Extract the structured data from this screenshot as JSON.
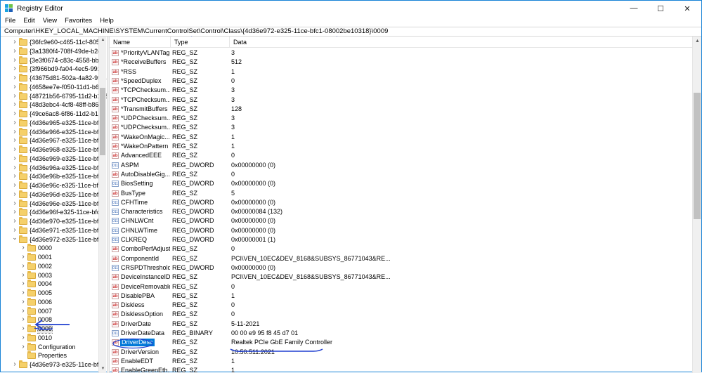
{
  "window": {
    "title": "Registry Editor",
    "icon": "registry-editor-icon",
    "controls": {
      "minimize": "—",
      "maximize": "☐",
      "close": "✕"
    }
  },
  "menu": [
    "File",
    "Edit",
    "View",
    "Favorites",
    "Help"
  ],
  "address": {
    "prefix": "Computer\\HKEY_LOCAL_MACHINE\\SYSTEM\\CurrentControlSet\\Control\\Class\\",
    "highlighted": "{4d36e972-e325-11ce-bfc1-08002be10318}\\0009"
  },
  "tree": {
    "items": [
      {
        "label": "{36fc9e60-c465-11cf-8056-",
        "level": 1,
        "expanded": false
      },
      {
        "label": "{3a1380f4-708f-49de-b2ef-",
        "level": 1,
        "expanded": false
      },
      {
        "label": "{3e3f0674-c83c-4558-bb26",
        "level": 1,
        "expanded": false
      },
      {
        "label": "{3f966bd9-fa04-4ec5-991c-",
        "level": 1,
        "expanded": false
      },
      {
        "label": "{43675d81-502a-4a82-9f84",
        "level": 1,
        "expanded": false
      },
      {
        "label": "{4658ee7e-f050-11d1-b6bd",
        "level": 1,
        "expanded": false
      },
      {
        "label": "{48721b56-6795-11d2-b1a8",
        "level": 1,
        "expanded": false
      },
      {
        "label": "{48d3ebc4-4cf8-48ff-b869-",
        "level": 1,
        "expanded": false
      },
      {
        "label": "{49ce6ac8-6f86-11d2-b1e5",
        "level": 1,
        "expanded": false
      },
      {
        "label": "{4d36e965-e325-11ce-bfc1",
        "level": 1,
        "expanded": false
      },
      {
        "label": "{4d36e966-e325-11ce-bfc1",
        "level": 1,
        "expanded": false
      },
      {
        "label": "{4d36e967-e325-11ce-bfc1",
        "level": 1,
        "expanded": false
      },
      {
        "label": "{4d36e968-e325-11ce-bfc1",
        "level": 1,
        "expanded": false
      },
      {
        "label": "{4d36e969-e325-11ce-bfc1",
        "level": 1,
        "expanded": false
      },
      {
        "label": "{4d36e96a-e325-11ce-bfc1",
        "level": 1,
        "expanded": false
      },
      {
        "label": "{4d36e96b-e325-11ce-bfc1",
        "level": 1,
        "expanded": false
      },
      {
        "label": "{4d36e96c-e325-11ce-bfc1",
        "level": 1,
        "expanded": false
      },
      {
        "label": "{4d36e96d-e325-11ce-bfc1",
        "level": 1,
        "expanded": false
      },
      {
        "label": "{4d36e96e-e325-11ce-bfc1",
        "level": 1,
        "expanded": false
      },
      {
        "label": "{4d36e96f-e325-11ce-bfc1-",
        "level": 1,
        "expanded": false
      },
      {
        "label": "{4d36e970-e325-11ce-bfc1",
        "level": 1,
        "expanded": false
      },
      {
        "label": "{4d36e971-e325-11ce-bfc1",
        "level": 1,
        "expanded": false
      },
      {
        "label": "{4d36e972-e325-11ce-bfc1",
        "level": 1,
        "expanded": true
      },
      {
        "label": "0000",
        "level": 2,
        "expanded": false
      },
      {
        "label": "0001",
        "level": 2,
        "expanded": false
      },
      {
        "label": "0002",
        "level": 2,
        "expanded": false
      },
      {
        "label": "0003",
        "level": 2,
        "expanded": false
      },
      {
        "label": "0004",
        "level": 2,
        "expanded": false
      },
      {
        "label": "0005",
        "level": 2,
        "expanded": false
      },
      {
        "label": "0006",
        "level": 2,
        "expanded": false
      },
      {
        "label": "0007",
        "level": 2,
        "expanded": false
      },
      {
        "label": "0008",
        "level": 2,
        "expanded": false
      },
      {
        "label": "0009",
        "level": 2,
        "expanded": false,
        "selected": true
      },
      {
        "label": "0010",
        "level": 2,
        "expanded": false
      },
      {
        "label": "Configuration",
        "level": 2,
        "expanded": false
      },
      {
        "label": "Properties",
        "level": 2,
        "leaf": true
      },
      {
        "label": "{4d36e973-e325-11ce-bfc1",
        "level": 1,
        "expanded": false
      }
    ]
  },
  "columns": {
    "name": "Name",
    "type": "Type",
    "data": "Data"
  },
  "values": [
    {
      "name": "*PriorityVLANTag",
      "type": "REG_SZ",
      "data": "3"
    },
    {
      "name": "*ReceiveBuffers",
      "type": "REG_SZ",
      "data": "512"
    },
    {
      "name": "*RSS",
      "type": "REG_SZ",
      "data": "1"
    },
    {
      "name": "*SpeedDuplex",
      "type": "REG_SZ",
      "data": "0"
    },
    {
      "name": "*TCPChecksum...",
      "type": "REG_SZ",
      "data": "3"
    },
    {
      "name": "*TCPChecksum...",
      "type": "REG_SZ",
      "data": "3"
    },
    {
      "name": "*TransmitBuffers",
      "type": "REG_SZ",
      "data": "128"
    },
    {
      "name": "*UDPChecksum...",
      "type": "REG_SZ",
      "data": "3"
    },
    {
      "name": "*UDPChecksum...",
      "type": "REG_SZ",
      "data": "3"
    },
    {
      "name": "*WakeOnMagic...",
      "type": "REG_SZ",
      "data": "1"
    },
    {
      "name": "*WakeOnPattern",
      "type": "REG_SZ",
      "data": "1"
    },
    {
      "name": "AdvancedEEE",
      "type": "REG_SZ",
      "data": "0"
    },
    {
      "name": "ASPM",
      "type": "REG_DWORD",
      "data": "0x00000000 (0)"
    },
    {
      "name": "AutoDisableGig...",
      "type": "REG_SZ",
      "data": "0"
    },
    {
      "name": "BiosSetting",
      "type": "REG_DWORD",
      "data": "0x00000000 (0)"
    },
    {
      "name": "BusType",
      "type": "REG_SZ",
      "data": "5"
    },
    {
      "name": "CFHTime",
      "type": "REG_DWORD",
      "data": "0x00000000 (0)"
    },
    {
      "name": "Characteristics",
      "type": "REG_DWORD",
      "data": "0x00000084 (132)"
    },
    {
      "name": "CHNLWCnt",
      "type": "REG_DWORD",
      "data": "0x00000000 (0)"
    },
    {
      "name": "CHNLWTime",
      "type": "REG_DWORD",
      "data": "0x00000000 (0)"
    },
    {
      "name": "CLKREQ",
      "type": "REG_DWORD",
      "data": "0x00000001 (1)"
    },
    {
      "name": "ComboPerfAdjust",
      "type": "REG_SZ",
      "data": "0"
    },
    {
      "name": "ComponentId",
      "type": "REG_SZ",
      "data": "PCI\\VEN_10EC&DEV_8168&SUBSYS_86771043&RE..."
    },
    {
      "name": "CRSPDThreshold",
      "type": "REG_DWORD",
      "data": "0x00000000 (0)"
    },
    {
      "name": "DeviceInstanceID",
      "type": "REG_SZ",
      "data": "PCI\\VEN_10EC&DEV_8168&SUBSYS_86771043&RE..."
    },
    {
      "name": "DeviceRemovable",
      "type": "REG_SZ",
      "data": "0"
    },
    {
      "name": "DisablePBA",
      "type": "REG_SZ",
      "data": "1"
    },
    {
      "name": "Diskless",
      "type": "REG_SZ",
      "data": "0"
    },
    {
      "name": "DisklessOption",
      "type": "REG_SZ",
      "data": "0"
    },
    {
      "name": "DriverDate",
      "type": "REG_SZ",
      "data": "5-11-2021"
    },
    {
      "name": "DriverDateData",
      "type": "REG_BINARY",
      "data": "00 00 e9 95 f8 45 d7 01"
    },
    {
      "name": "DriverDesc",
      "type": "REG_SZ",
      "data": "Realtek PCIe GbE Family Controller",
      "selected": true
    },
    {
      "name": "DriverVersion",
      "type": "REG_SZ",
      "data": "10.50.511.2021"
    },
    {
      "name": "EnableEDT",
      "type": "REG_SZ",
      "data": "1"
    },
    {
      "name": "EnableGreenEth...",
      "type": "REG_SZ",
      "data": "1"
    }
  ],
  "colors": {
    "selection": "#0078d7",
    "annotation": "#1f3fd0"
  }
}
